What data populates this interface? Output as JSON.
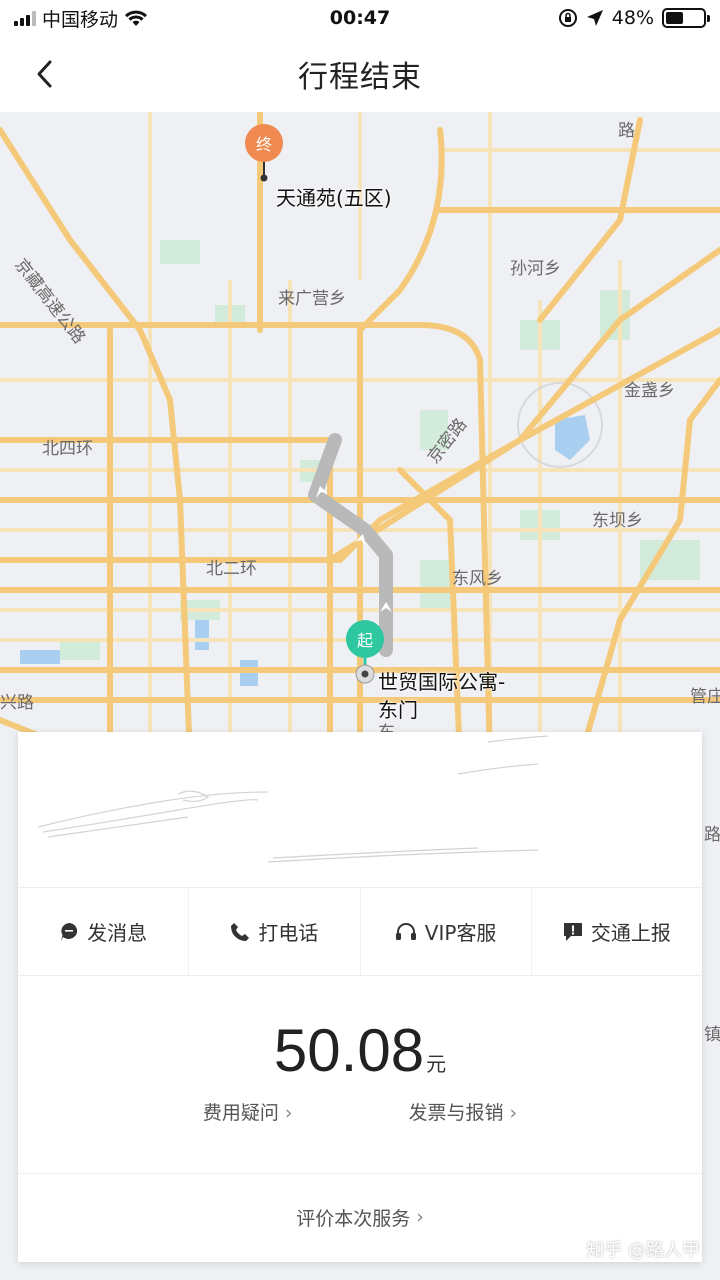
{
  "status_bar": {
    "carrier": "中国移动",
    "time": "00:47",
    "battery": "48%",
    "battery_level": 0.48
  },
  "nav": {
    "title": "行程结束"
  },
  "map": {
    "end_pin": "终",
    "start_pin": "起",
    "end_place": "天通苑(五区)",
    "start_place_line1": "世贸国际公寓-",
    "start_place_line2": "东门",
    "labels": {
      "jingzang": "京藏高速公路",
      "laiguangying": "来广营乡",
      "sunhe": "孙河乡",
      "jinzhan": "金盏乡",
      "beisihuan": "北四环",
      "jingmi": "京密路",
      "dongba": "东坝乡",
      "beierhuan": "北二环",
      "dongfeng": "东风乡",
      "xinglu": "兴路",
      "guanzhuang": "管庄",
      "lu": "路",
      "dong": "东",
      "lu_right": "路",
      "zhen_right": "镇"
    }
  },
  "actions": {
    "message": "发消息",
    "call": "打电话",
    "vip": "VIP客服",
    "report": "交通上报"
  },
  "fare": {
    "amount": "50.08",
    "unit": "元",
    "question": "费用疑问",
    "invoice": "发票与报销"
  },
  "rate": {
    "label": "评价本次服务"
  },
  "watermark": "知乎 @路人甲",
  "colors": {
    "map_bg": "#eef0f3",
    "road_major": "#f5c97a",
    "road_minor": "#f7e3b8",
    "route": "#b9b9b9",
    "start_pin": "#2ec7a0",
    "end_pin": "#f08a50",
    "green_area": "#cfead8",
    "water": "#a8cff0"
  }
}
